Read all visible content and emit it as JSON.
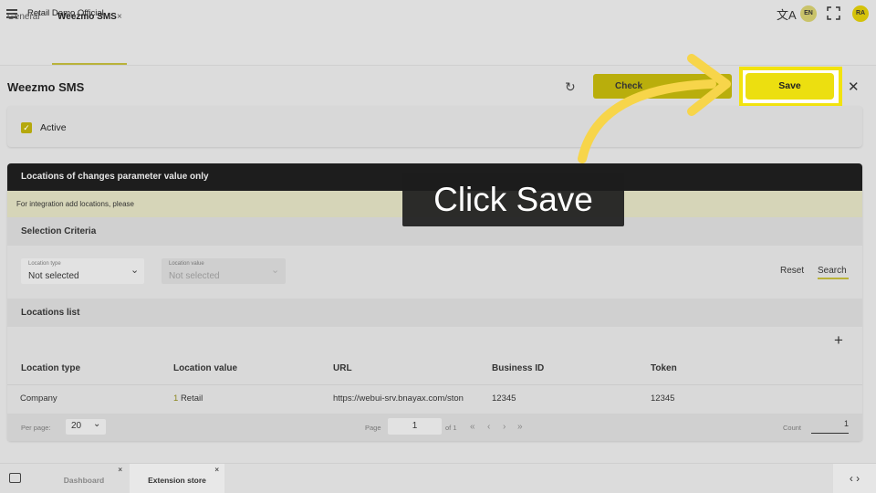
{
  "topbar": {
    "app_title": "Retail Demo Official",
    "lang_badge": "EN",
    "avatar_initials": "RA",
    "translate_glyph": "文A"
  },
  "tabs": [
    {
      "label": "General"
    },
    {
      "label": "Weezmo SMS"
    }
  ],
  "page": {
    "title": "Weezmo SMS",
    "check_button": "Check",
    "save_button": "Save",
    "accent_color": "#ecdf10"
  },
  "active": {
    "label": "Active"
  },
  "panel": {
    "title": "Locations of changes parameter value only",
    "info": "For integration add locations, please"
  },
  "selection": {
    "title": "Selection Criteria",
    "location_type": {
      "label": "Location type",
      "value": "Not selected"
    },
    "location_value": {
      "label": "Location value",
      "value": "Not selected"
    },
    "reset": "Reset",
    "search": "Search"
  },
  "locations": {
    "title": "Locations list",
    "columns": [
      "Location type",
      "Location value",
      "URL",
      "Business ID",
      "Token"
    ],
    "rows": [
      {
        "type": "Company",
        "value_num": "1",
        "value_text": "Retail",
        "url": "https://webui-srv.bnayax.com/ston",
        "business_id": "12345",
        "token": "12345"
      }
    ]
  },
  "pager": {
    "per_page_label": "Per page:",
    "per_page_value": "20",
    "page_label": "Page",
    "page_value": "1",
    "of_label": "of 1",
    "count_label": "Count",
    "count_value": "1"
  },
  "bottom_tabs": [
    {
      "label": "Dashboard"
    },
    {
      "label": "Extension store"
    }
  ],
  "overlay": {
    "text": "Click Save"
  }
}
